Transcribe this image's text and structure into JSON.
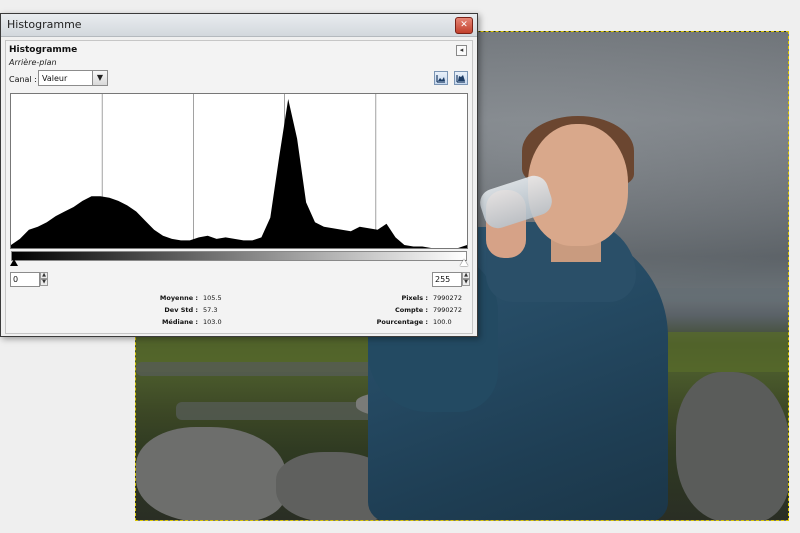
{
  "window": {
    "title": "Histogramme",
    "close_glyph": "✕"
  },
  "panel": {
    "title": "Histogramme",
    "subtitle": "Arrière-plan",
    "collapse_glyph": "◂"
  },
  "channel": {
    "label": "Canal :",
    "selected": "Valeur",
    "arrow_glyph": "▼"
  },
  "range": {
    "low": "0",
    "high": "255",
    "spin_up": "▲",
    "spin_down": "▼"
  },
  "stats": {
    "mean_label": "Moyenne :",
    "mean_value": "105.5",
    "std_label": "Dev Std :",
    "std_value": "57.3",
    "median_label": "Médiane :",
    "median_value": "103.0",
    "pixels_label": "Pixels :",
    "pixels_value": "7990272",
    "count_label": "Compte :",
    "count_value": "7990272",
    "percent_label": "Pourcentage :",
    "percent_value": "100.0"
  },
  "icons": {
    "linear_scale": "linear-histogram-icon",
    "log_scale": "logarithmic-histogram-icon"
  },
  "chart_data": {
    "type": "area",
    "x": [
      0,
      5,
      10,
      15,
      20,
      25,
      30,
      35,
      40,
      45,
      50,
      55,
      60,
      65,
      70,
      75,
      80,
      85,
      90,
      95,
      100,
      105,
      110,
      115,
      120,
      125,
      130,
      135,
      140,
      145,
      150,
      155,
      160,
      165,
      170,
      175,
      180,
      185,
      190,
      195,
      200,
      205,
      210,
      215,
      220,
      225,
      230,
      235,
      240,
      245,
      250,
      255
    ],
    "values": [
      2,
      6,
      12,
      14,
      17,
      21,
      24,
      27,
      31,
      34,
      34,
      33,
      31,
      28,
      24,
      18,
      12,
      8,
      6,
      5,
      5,
      7,
      8,
      6,
      7,
      6,
      5,
      5,
      7,
      20,
      60,
      98,
      72,
      30,
      17,
      14,
      13,
      12,
      11,
      14,
      13,
      12,
      16,
      7,
      2,
      1,
      1,
      0,
      0,
      0,
      0,
      2
    ],
    "xlim": [
      0,
      255
    ],
    "ylim": [
      0,
      100
    ],
    "gridlines_x": [
      0.2,
      0.4,
      0.6,
      0.8
    ]
  }
}
